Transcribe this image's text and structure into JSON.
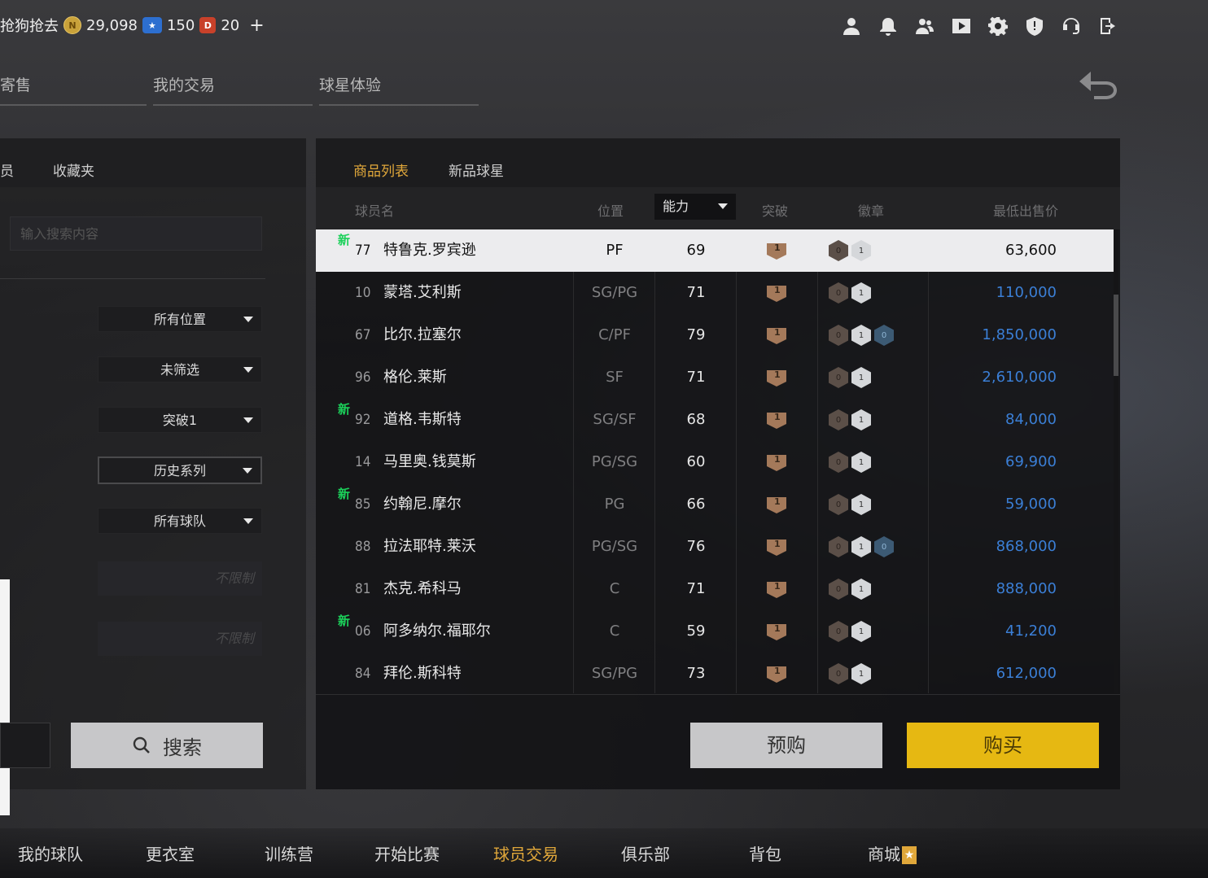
{
  "top": {
    "title": "抢狗抢去",
    "coins": "29,098",
    "stars": "150",
    "tickets": "20",
    "plus": "+"
  },
  "icons": [
    "profile-icon",
    "bell-icon",
    "friends-icon",
    "video-icon",
    "gear-icon",
    "shield-icon",
    "support-icon",
    "exit-icon"
  ],
  "navtabs": [
    "寄售",
    "我的交易",
    "球星体验"
  ],
  "left": {
    "tabs": [
      "员",
      "收藏夹"
    ],
    "search_placeholder": "输入搜索内容",
    "filters": [
      "所有位置",
      "未筛选",
      "突破1",
      "历史系列",
      "所有球队"
    ],
    "range_placeholder": "不限制",
    "search_button": "搜索"
  },
  "market": {
    "tabs": [
      "商品列表",
      "新品球星"
    ],
    "headers": {
      "name": "球员名",
      "position": "位置",
      "ability": "能力",
      "break": "突破",
      "badge": "徽章",
      "price": "最低出售价"
    },
    "rows": [
      {
        "new": true,
        "num": "77",
        "name": "特鲁克.罗宾逊",
        "pos": "PF",
        "ovr": "69",
        "badges": [
          "0",
          "1"
        ],
        "price": "63,600"
      },
      {
        "new": false,
        "num": "10",
        "name": "蒙塔.艾利斯",
        "pos": "SG/PG",
        "ovr": "71",
        "badges": [
          "0",
          "1"
        ],
        "price": "110,000"
      },
      {
        "new": false,
        "num": "67",
        "name": "比尔.拉塞尔",
        "pos": "C/PF",
        "ovr": "79",
        "badges": [
          "0",
          "1",
          "0"
        ],
        "price": "1,850,000"
      },
      {
        "new": false,
        "num": "96",
        "name": "格伦.莱斯",
        "pos": "SF",
        "ovr": "71",
        "badges": [
          "0",
          "1"
        ],
        "price": "2,610,000"
      },
      {
        "new": true,
        "num": "92",
        "name": "道格.韦斯特",
        "pos": "SG/SF",
        "ovr": "68",
        "badges": [
          "0",
          "1"
        ],
        "price": "84,000"
      },
      {
        "new": false,
        "num": "14",
        "name": "马里奥.钱莫斯",
        "pos": "PG/SG",
        "ovr": "60",
        "badges": [
          "0",
          "1"
        ],
        "price": "69,900"
      },
      {
        "new": true,
        "num": "85",
        "name": "约翰尼.摩尔",
        "pos": "PG",
        "ovr": "66",
        "badges": [
          "0",
          "1"
        ],
        "price": "59,000"
      },
      {
        "new": false,
        "num": "88",
        "name": "拉法耶特.莱沃",
        "pos": "PG/SG",
        "ovr": "76",
        "badges": [
          "0",
          "1",
          "0"
        ],
        "price": "868,000"
      },
      {
        "new": false,
        "num": "81",
        "name": "杰克.希科马",
        "pos": "C",
        "ovr": "71",
        "badges": [
          "0",
          "1"
        ],
        "price": "888,000"
      },
      {
        "new": true,
        "num": "06",
        "name": "阿多纳尔.福耶尔",
        "pos": "C",
        "ovr": "59",
        "badges": [
          "0",
          "1"
        ],
        "price": "41,200"
      },
      {
        "new": false,
        "num": "84",
        "name": "拜伦.斯科特",
        "pos": "SG/PG",
        "ovr": "73",
        "badges": [
          "0",
          "1"
        ],
        "price": "612,000"
      }
    ],
    "new_tag": "新",
    "break_level": "1",
    "prebuy": "预购",
    "buy": "购买"
  },
  "bottomnav": [
    "我的球队",
    "更衣室",
    "训练营",
    "开始比赛",
    "球员交易",
    "俱乐部",
    "背包",
    "商城"
  ],
  "colors": {
    "accent": "#e0a73a",
    "buy": "#e6b812",
    "price": "#3b7fd6",
    "new": "#1bd15a"
  }
}
